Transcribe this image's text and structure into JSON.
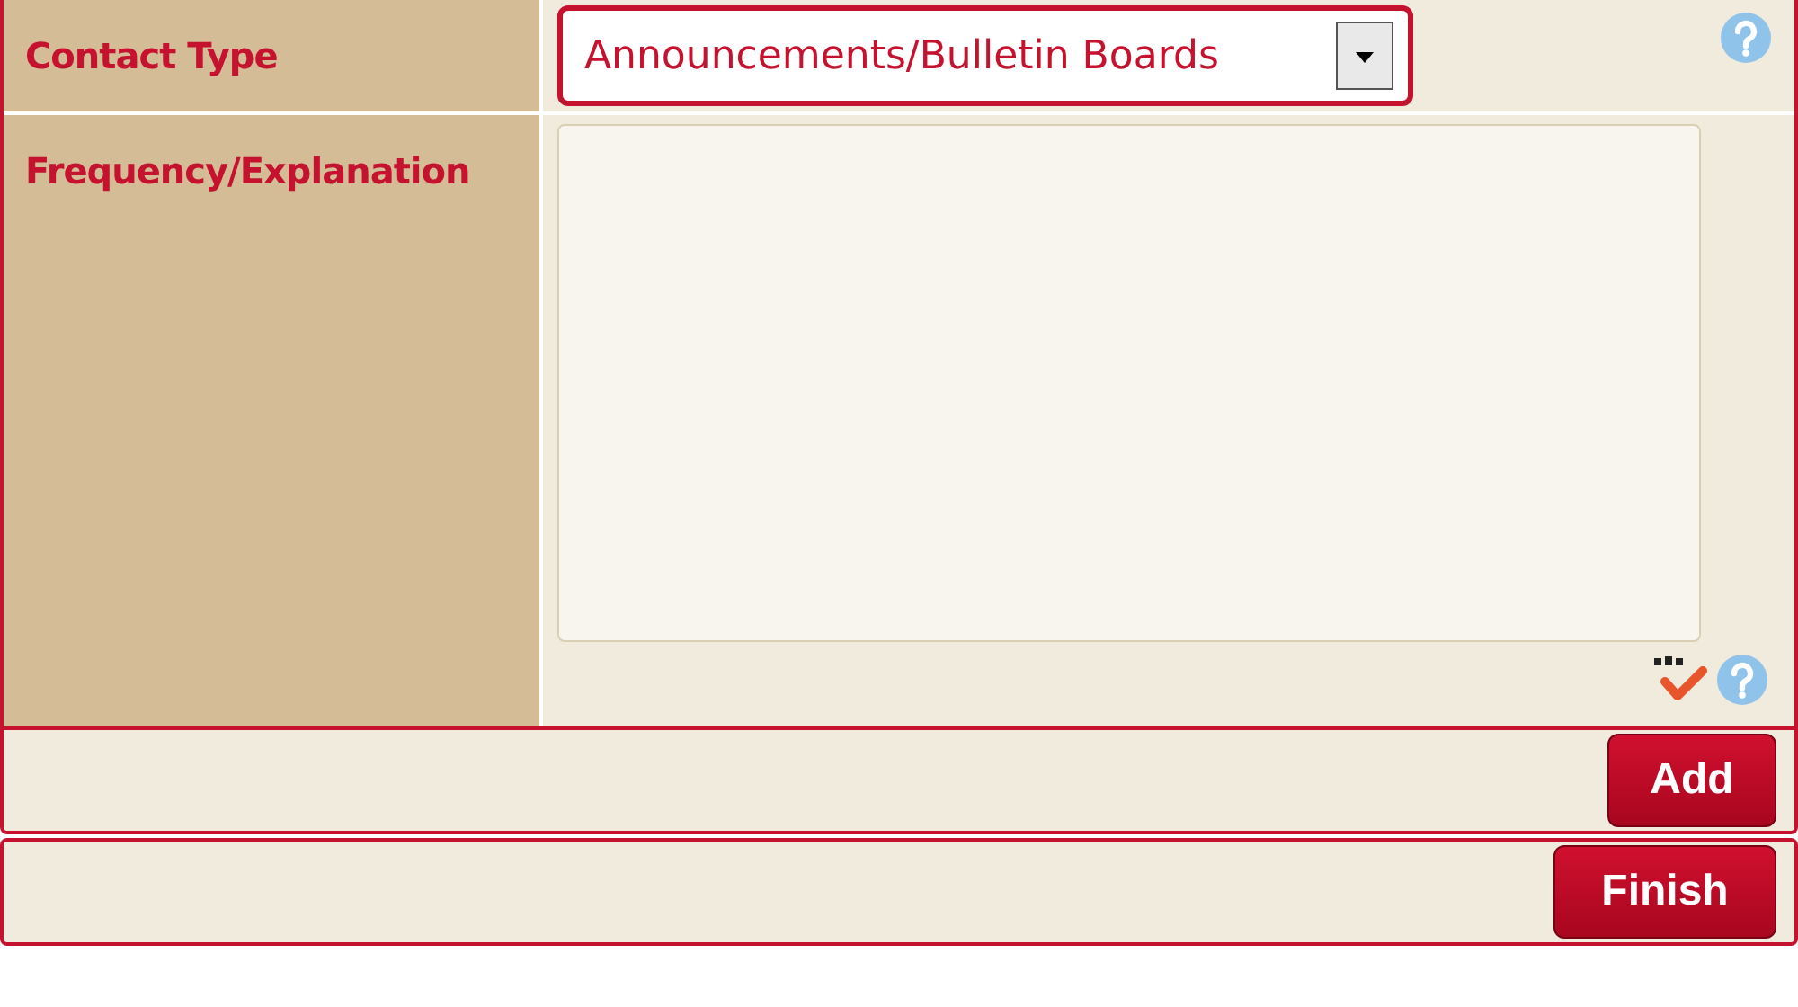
{
  "fields": [
    {
      "kind": "select",
      "label": "Contact Type",
      "value": "Announcements/Bulletin Boards"
    },
    {
      "kind": "textarea",
      "label": "Frequency/Explanation"
    }
  ],
  "add_button": "Add",
  "finish_button": "Finish"
}
